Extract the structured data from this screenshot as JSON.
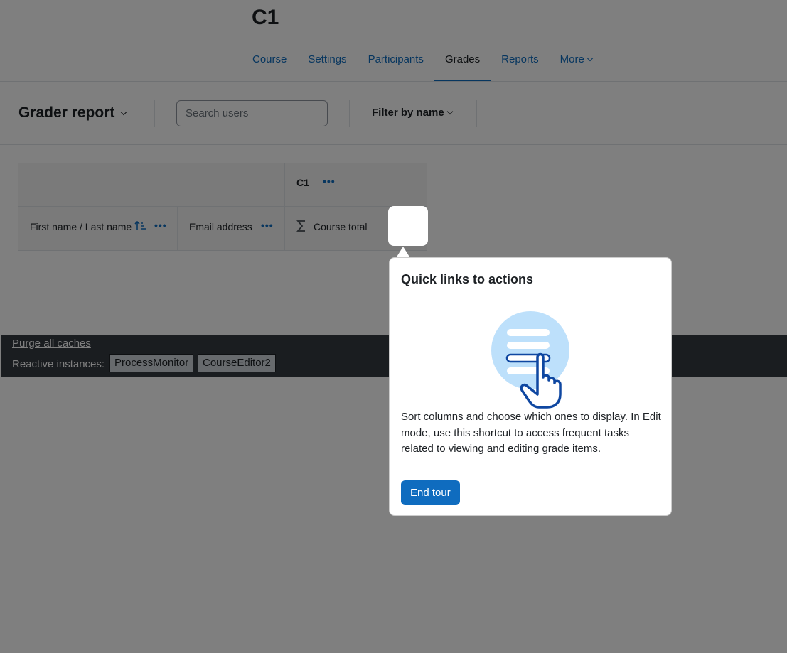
{
  "header": {
    "course_title": "C1",
    "nav": [
      {
        "label": "Course"
      },
      {
        "label": "Settings"
      },
      {
        "label": "Participants"
      },
      {
        "label": "Grades"
      },
      {
        "label": "Reports"
      },
      {
        "label": "More"
      }
    ],
    "active_tab": "Grades"
  },
  "tertiary": {
    "report_select": "Grader report",
    "search_placeholder": "Search users",
    "filter_label": "Filter by name"
  },
  "table": {
    "category_header": "C1",
    "columns": [
      "First name / Last name",
      "Email address",
      "Course total"
    ],
    "actions_glyph": "•••"
  },
  "footer": {
    "purge_link": "Purge all caches",
    "reactive_label": "Reactive instances:",
    "instances": [
      "ProcessMonitor",
      "CourseEditor2"
    ]
  },
  "tour": {
    "title": "Quick links to actions",
    "body": "Sort columns and choose which ones to display. In Edit mode, use this shortcut to access frequent tasks related to viewing and editing grade items.",
    "end_label": "End tour"
  },
  "colors": {
    "accent": "#0f6cbf",
    "footer_bg": "#343a40",
    "overlay": "rgba(0,0,0,0.5)"
  },
  "icons": {
    "sort": "sort-asc-icon",
    "sigma": "sigma-icon",
    "actions": "ellipsis-icon",
    "illustration": "hand-pointer-list-icon"
  }
}
